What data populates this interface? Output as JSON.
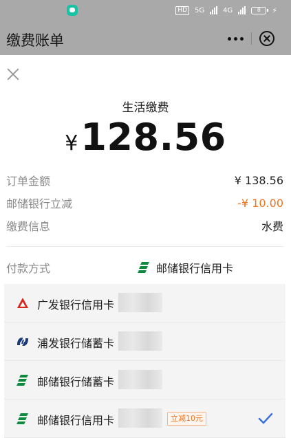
{
  "status_bar": {
    "hd_label": "HD",
    "net1": "5G",
    "net2": "4G",
    "battery": "8"
  },
  "header": {
    "title": "缴费账单"
  },
  "payment": {
    "title": "生活缴费",
    "currency": "¥",
    "amount": "128.56"
  },
  "details": [
    {
      "label": "订单金额",
      "value": "¥ 138.56"
    },
    {
      "label": "邮储银行立减",
      "value": "-¥ 10.00"
    },
    {
      "label": "缴费信息",
      "value": "水费"
    }
  ],
  "pay_method": {
    "label": "付款方式",
    "selected": "邮储银行信用卡"
  },
  "cards": [
    {
      "name": "广发银行信用卡",
      "icon": "cgb-logo-icon"
    },
    {
      "name": "浦发银行储蓄卡",
      "icon": "spdb-logo-icon"
    },
    {
      "name": "邮储银行储蓄卡",
      "icon": "psbc-logo-icon"
    },
    {
      "name": "邮储银行信用卡",
      "icon": "psbc-logo-icon",
      "promo": "立减10元",
      "selected": true
    }
  ],
  "colors": {
    "accent_orange": "#f0731e",
    "check_blue": "#3a6fe0",
    "psbc_green": "#0c8a3e",
    "cgb_red": "#d9261c",
    "spdb_navy": "#1a3a7a"
  }
}
